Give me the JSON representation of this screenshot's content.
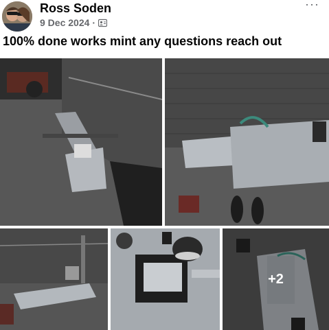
{
  "post": {
    "author": "Ross Soden",
    "date": "9 Dec 2024",
    "separator": "·",
    "privacy_icon": "friends-icon",
    "more_label": "···",
    "caption": "100% done works mint any questions reach out"
  },
  "photos": {
    "more_count_label": "+2"
  },
  "colors": {
    "text": "#050505",
    "secondary_text": "#65676b",
    "background": "#ffffff"
  }
}
